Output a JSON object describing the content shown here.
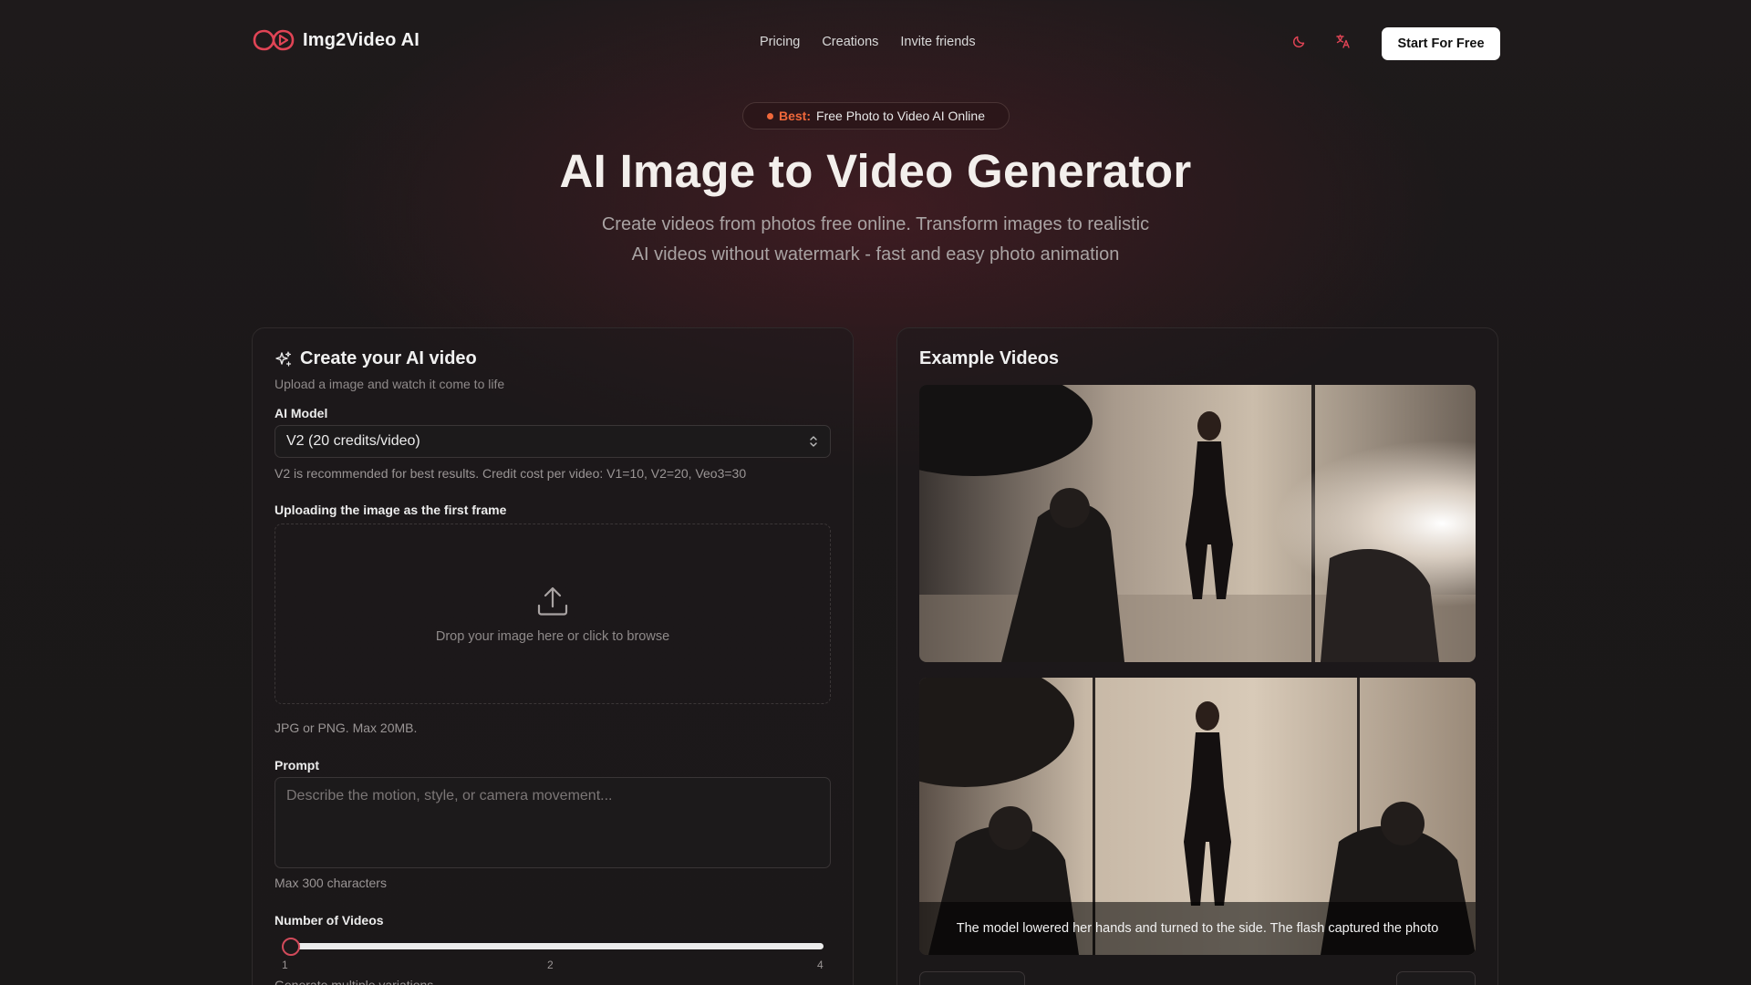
{
  "header": {
    "brand": "Img2Video AI",
    "nav": [
      "Pricing",
      "Creations",
      "Invite friends"
    ],
    "theme_icon": "moon-icon",
    "lang_icon": "translate-icon",
    "cta": "Start For Free"
  },
  "hero": {
    "badge_strong": "Best:",
    "badge_text": "Free Photo to Video AI Online",
    "title": "AI Image to Video Generator",
    "subtitle_line1": "Create videos from photos free online. Transform images to realistic",
    "subtitle_line2": "AI videos without watermark - fast and easy photo animation"
  },
  "create": {
    "title": "Create your AI video",
    "description": "Upload a image and watch it come to life",
    "model_label": "AI Model",
    "model_value": "V2 (20 credits/video)",
    "model_hint": "V2 is recommended for best results. Credit cost per video: V1=10, V2=20, Veo3=30",
    "upload_label": "Uploading the image as the first frame",
    "upload_text": "Drop your image here or click to browse",
    "upload_hint": "JPG or PNG. Max 20MB.",
    "prompt_label": "Prompt",
    "prompt_placeholder": "Describe the motion, style, or camera movement...",
    "prompt_hint": "Max 300 characters",
    "count_label": "Number of Videos",
    "count_value": 1,
    "ticks": [
      "1",
      "2",
      "4"
    ],
    "count_hint": "Generate multiple variations"
  },
  "examples": {
    "title": "Example Videos",
    "caption": "The model lowered her hands and turned to the side. The flash captured the photo"
  },
  "colors": {
    "accent": "#d14a5a",
    "badge_accent": "#f0683a",
    "background": "#1b1819"
  }
}
